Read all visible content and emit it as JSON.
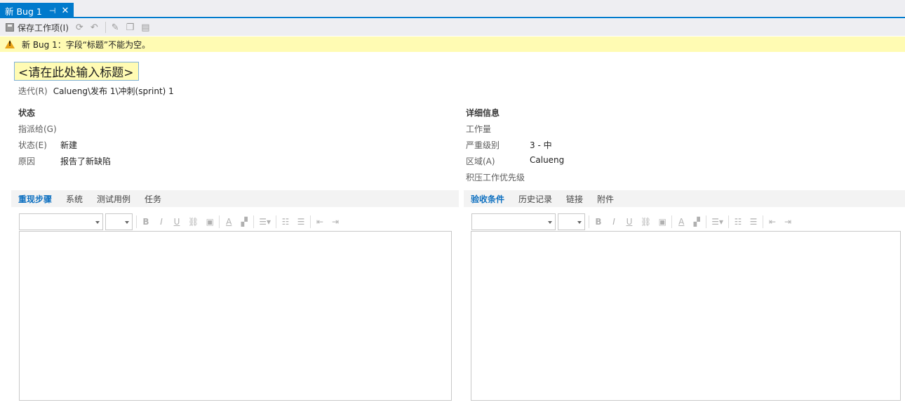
{
  "tab": {
    "label": "新 Bug 1",
    "pin_glyph": "⊣",
    "close_glyph": "✕"
  },
  "toolbar": {
    "save_label": "保存工作项(I)"
  },
  "warning": {
    "message": "新 Bug 1：字段“标题”不能为空。"
  },
  "title": {
    "placeholder": "<请在此处输入标题>"
  },
  "iteration": {
    "label": "迭代(R)",
    "value": "Calueng\\发布 1\\冲刺(sprint) 1"
  },
  "status_section": {
    "header": "状态",
    "assigned_label": "指派给(G)",
    "state_label": "状态(E)",
    "state_value": "新建",
    "reason_label": "原因",
    "reason_value": "报告了新缺陷"
  },
  "details_section": {
    "header": "详细信息",
    "effort_label": "工作量",
    "severity_label": "严重级别",
    "severity_value": "3 - 中",
    "area_label": "区域(A)",
    "area_value": "Calueng",
    "backlog_priority_label": "积压工作优先级"
  },
  "left_tabs": [
    {
      "label": "重现步骤"
    },
    {
      "label": "系统"
    },
    {
      "label": "测试用例"
    },
    {
      "label": "任务"
    }
  ],
  "right_tabs": [
    {
      "label": "验收条件"
    },
    {
      "label": "历史记录"
    },
    {
      "label": "链接"
    },
    {
      "label": "附件"
    }
  ],
  "format_buttons": {
    "bold": "B",
    "italic": "I",
    "underline": "U",
    "font_color": "A"
  },
  "colors": {
    "accent": "#007acc",
    "warning_bg": "#fffbb3",
    "active_tab": "#0e70c0"
  }
}
